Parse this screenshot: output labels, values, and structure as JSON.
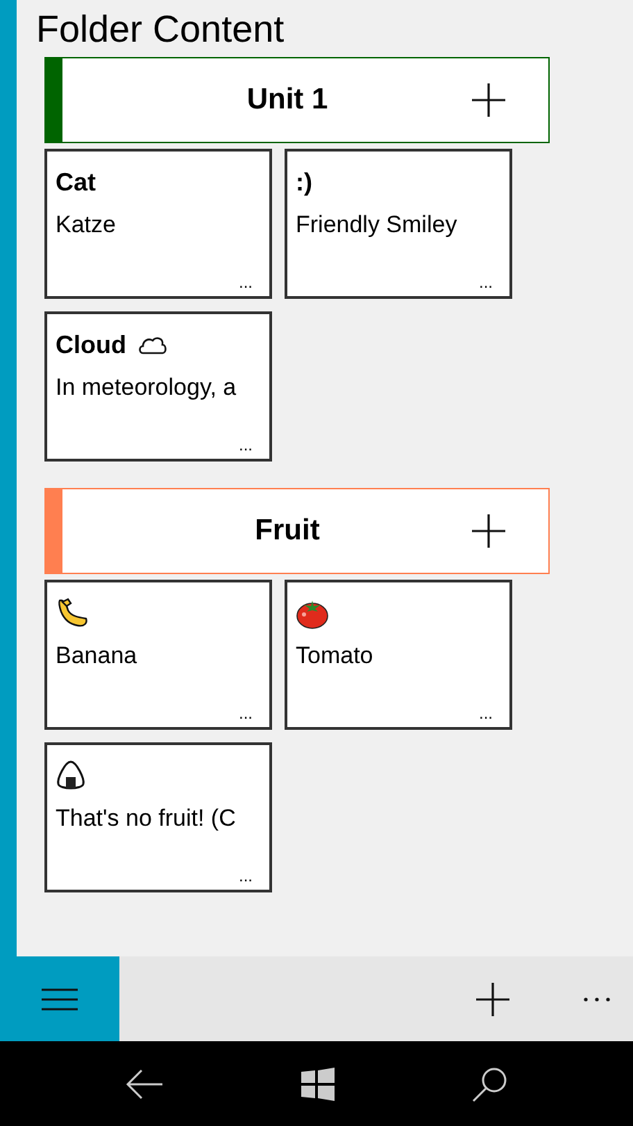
{
  "title": "Folder Content",
  "groups": [
    {
      "name": "Unit 1",
      "color": "#006400",
      "cards": [
        {
          "kind": "text",
          "title": "Cat",
          "text": "Katze",
          "more": "..."
        },
        {
          "kind": "text",
          "title": ":)",
          "text": "Friendly Smiley",
          "more": "..."
        },
        {
          "kind": "cloud",
          "title": "Cloud",
          "text": "In meteorology, a",
          "more": "..."
        }
      ]
    },
    {
      "name": "Fruit",
      "color": "#ff7f50",
      "cards": [
        {
          "kind": "banana",
          "text": "Banana",
          "more": "..."
        },
        {
          "kind": "tomato",
          "text": "Tomato",
          "more": "..."
        },
        {
          "kind": "riceball",
          "text": "That's no fruit! (C",
          "more": "..."
        }
      ]
    }
  ]
}
